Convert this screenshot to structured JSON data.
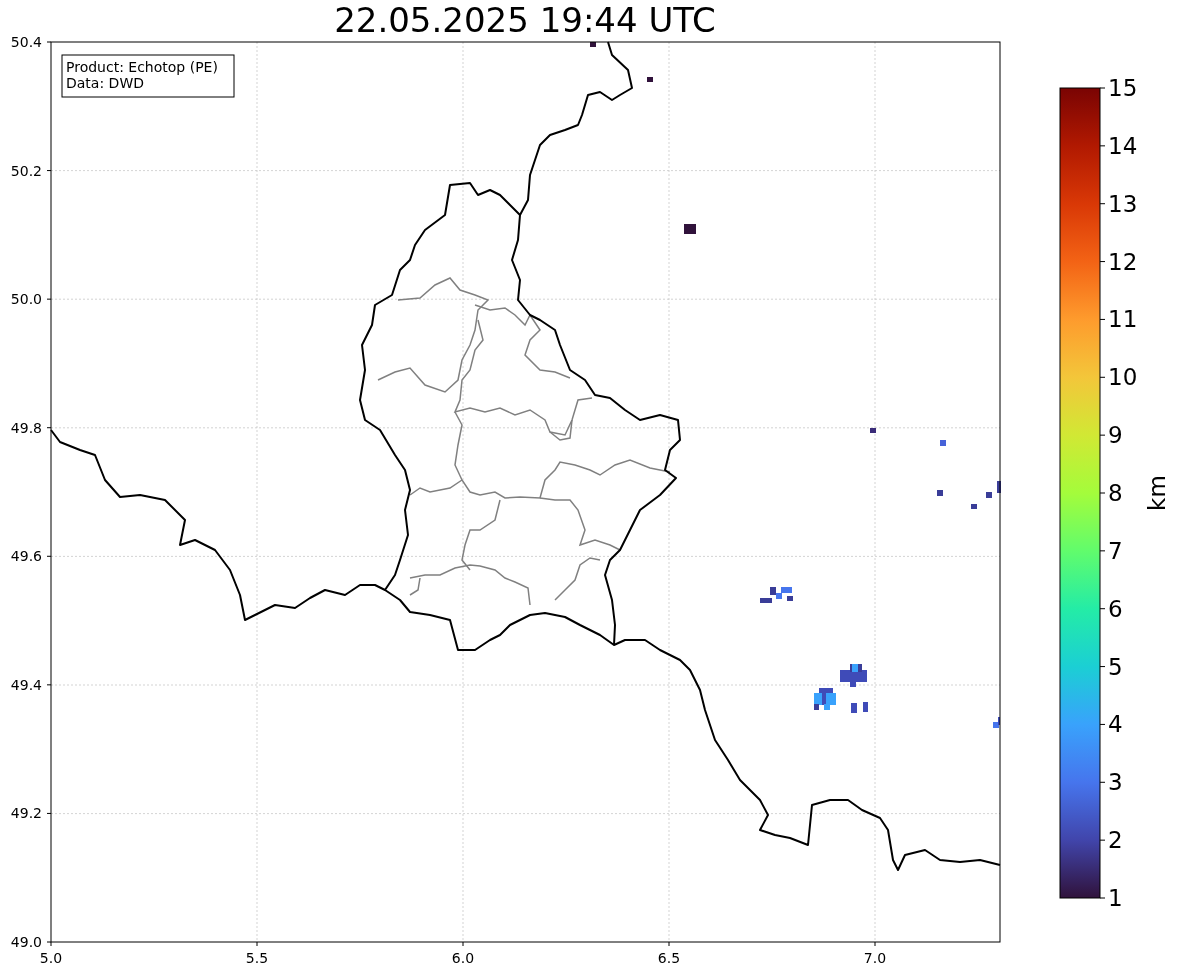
{
  "title": "22.05.2025 19:44 UTC",
  "info_box": {
    "lines": [
      "Product: Echotop (PE)",
      "Data: DWD"
    ]
  },
  "x_axis": {
    "ticks": [
      "5.0",
      "5.5",
      "6.0",
      "6.5",
      "7.0"
    ]
  },
  "y_axis": {
    "ticks": [
      "50.4",
      "50.2",
      "50.0",
      "49.8",
      "49.6",
      "49.4",
      "49.2",
      "49.0"
    ]
  },
  "colorbar": {
    "label": "km",
    "ticks": [
      "15",
      "14",
      "13",
      "12",
      "11",
      "10",
      "9",
      "8",
      "7",
      "6",
      "5",
      "4",
      "3",
      "2",
      "1"
    ]
  }
}
